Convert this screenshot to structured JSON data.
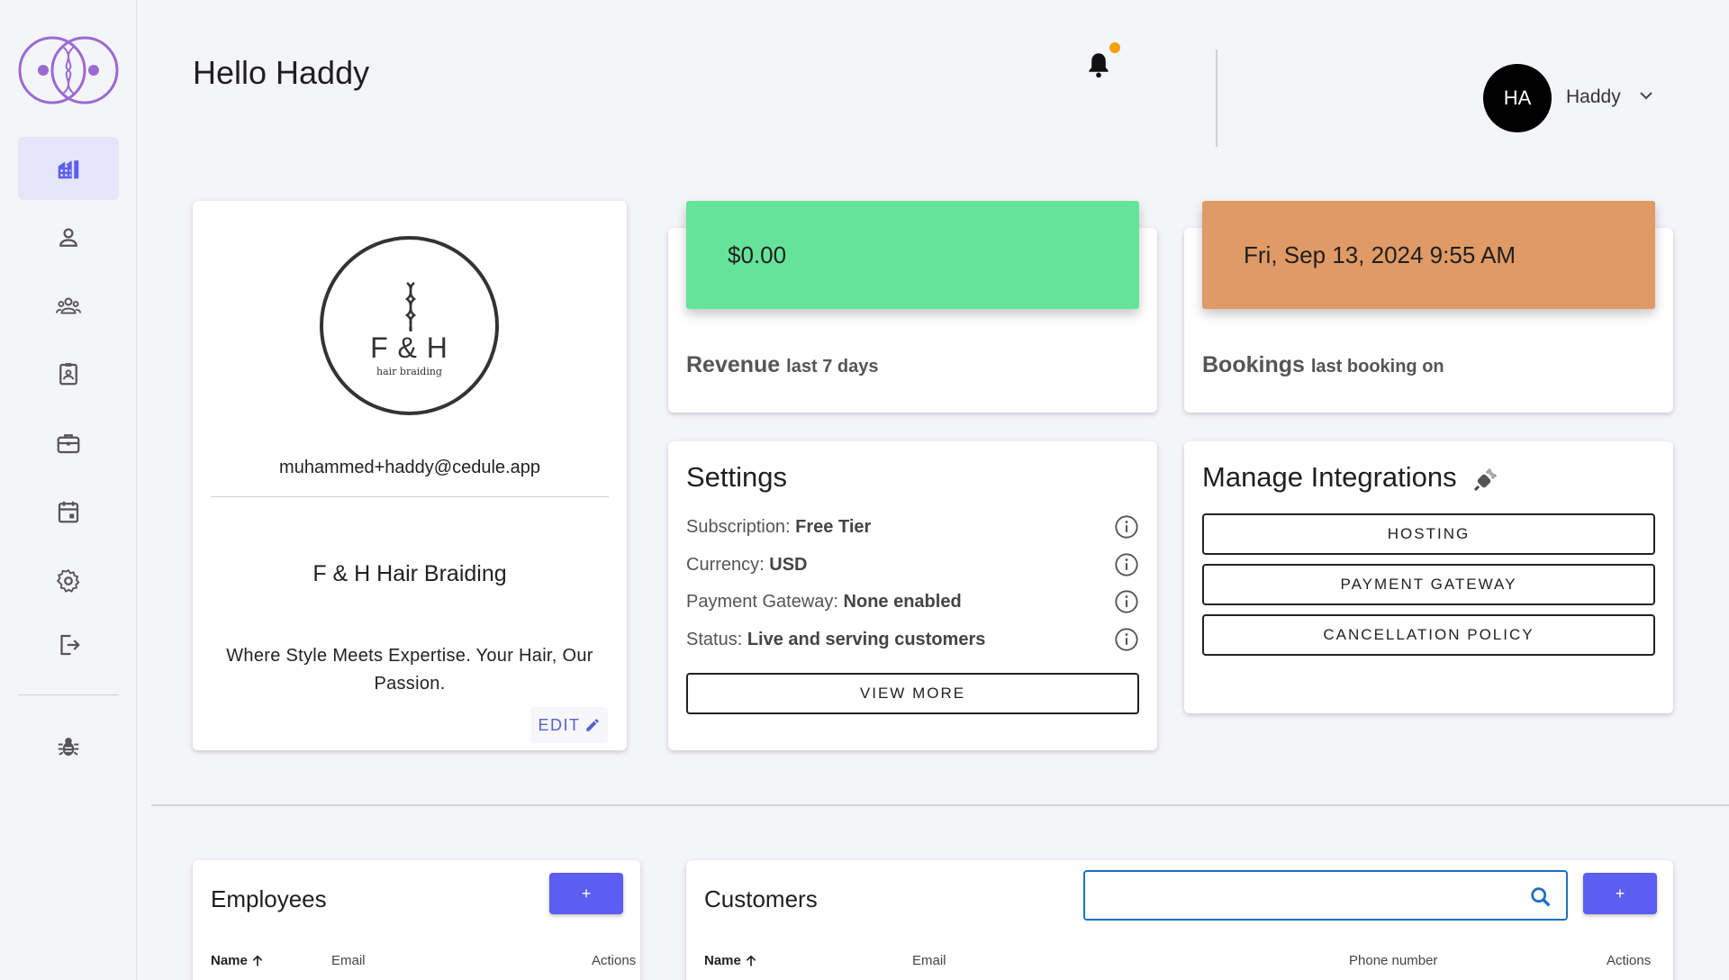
{
  "header": {
    "greeting": "Hello Haddy",
    "user_initials": "HA",
    "user_name": "Haddy"
  },
  "sidebar": {
    "items": [
      {
        "icon": "dashboard-icon",
        "active": true
      },
      {
        "icon": "person-icon"
      },
      {
        "icon": "group-icon"
      },
      {
        "icon": "clipboard-icon"
      },
      {
        "icon": "briefcase-icon"
      },
      {
        "icon": "calendar-icon"
      },
      {
        "icon": "settings-icon"
      },
      {
        "icon": "logout-icon"
      },
      {
        "icon": "bug-icon"
      }
    ]
  },
  "profile": {
    "logo_initials": "F & H",
    "logo_tag": "hair braiding",
    "email": "muhammed+haddy@cedule.app",
    "business_name": "F & H Hair Braiding",
    "tagline": "Where Style Meets Expertise. Your Hair, Our Passion.",
    "edit_label": "EDIT"
  },
  "revenue": {
    "value": "$0.00",
    "label": "Revenue",
    "sublabel": "last 7 days",
    "color": "#66e39a"
  },
  "bookings": {
    "value": "Fri, Sep 13, 2024 9:55 AM",
    "label": "Bookings",
    "sublabel": "last booking on",
    "color": "#e09a66"
  },
  "settings": {
    "title": "Settings",
    "rows": [
      {
        "label": "Subscription: ",
        "value": "Free Tier"
      },
      {
        "label": "Currency: ",
        "value": "USD"
      },
      {
        "label": "Payment Gateway: ",
        "value": "None enabled"
      },
      {
        "label": "Status: ",
        "value": "Live and serving customers"
      }
    ],
    "view_more": "VIEW MORE"
  },
  "integrations": {
    "title": "Manage Integrations",
    "buttons": [
      "HOSTING",
      "PAYMENT GATEWAY",
      "CANCELLATION POLICY"
    ]
  },
  "employees": {
    "title": "Employees",
    "add_label": "+",
    "columns": [
      "Name",
      "Email",
      "Actions"
    ]
  },
  "customers": {
    "title": "Customers",
    "add_label": "+",
    "search_placeholder": "",
    "columns": [
      "Name",
      "Email",
      "Phone number",
      "Actions"
    ]
  },
  "colors": {
    "accent": "#5b5ef0",
    "logo": "#9a6bd1",
    "notification": "#f2a010"
  }
}
